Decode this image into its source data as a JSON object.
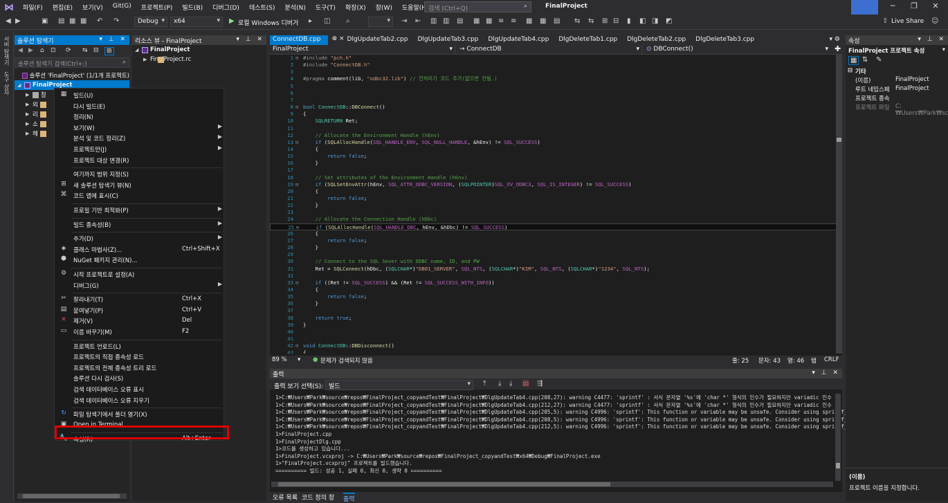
{
  "menubar": {
    "items": [
      "파일(F)",
      "편집(E)",
      "보기(V)",
      "Git(G)",
      "프로젝트(P)",
      "빌드(B)",
      "디버그(D)",
      "테스트(S)",
      "분석(N)",
      "도구(T)",
      "확장(X)",
      "창(W)",
      "도움말(H)"
    ],
    "search_placeholder": "검색 (Ctrl+Q)",
    "title": "FinalProject"
  },
  "toolbar": {
    "config": "Debug",
    "platform": "x64",
    "run_label": "로컬 Windows 디버거",
    "live_share": "Live Share"
  },
  "left_strip": [
    "서버 탐색기",
    "도구 상자"
  ],
  "solution_explorer": {
    "title": "솔루션 탐색기",
    "search_placeholder": "솔루션 탐색기 검색(Ctrl+;)",
    "items": [
      {
        "label": "솔루션 'FinalProject' (1/1개 프로젝트)"
      },
      {
        "label": "FinalProject"
      },
      {
        "label": "참"
      },
      {
        "label": "외"
      },
      {
        "label": "리"
      },
      {
        "label": "소"
      },
      {
        "label": "헤"
      }
    ]
  },
  "resource_view": {
    "title": "리소스 뷰 - FinalProject",
    "items": [
      "FinalProject",
      "FinalProject.rc"
    ]
  },
  "editor": {
    "tabs": [
      "ConnectDB.cpp",
      "DlgUpdateTab2.cpp",
      "DlgUpdateTab3.cpp",
      "DlgUpdateTab4.cpp",
      "DlgDeleteTab1.cpp",
      "DlgDeleteTab2.cpp",
      "DlgDeleteTab3.cpp"
    ],
    "nav_project": "FinalProject",
    "nav_class": "ConnectDB",
    "nav_member": "DBConnect()",
    "zoom": "89 %",
    "issues": "문제가 검색되지 않음",
    "line": "줄: 25",
    "char": "문자: 43",
    "col": "열: 46",
    "tab": "탭",
    "eol": "CRLF"
  },
  "code_lines": [
    "#include \"pch.h\"",
    "#include \"ConnectDB.h\"",
    "",
    "#pragma comment(lib, \"odbc32.lib\") // 전처리기 코드 추가(없으면 안됨.)",
    "",
    "",
    "",
    "bool ConnectDB::DBConnect()",
    "{",
    "    SQLRETURN Ret;",
    "",
    "    // Allocate the Environment Handle (hEnv)",
    "    if (SQLAllocHandle(SQL_HANDLE_ENV, SQL_NULL_HANDLE, &hEnv) != SQL_SUCCESS)",
    "    {",
    "        return false;",
    "    }",
    "",
    "    // Set attributes of the Environment Handle (hEnv)",
    "    if (SQLSetEnvAttr(hEnv, SQL_ATTR_ODBC_VERSION, (SQLPOINTER)SQL_OV_ODBC3, SQL_IS_INTEGER) != SQL_SUCCESS)",
    "    {",
    "        return false;",
    "    }",
    "",
    "    // Allocate the Connection Handle (hDbc)",
    "    if (SQLAllocHandle(SQL_HANDLE_DBC, hEnv, &hDbc) != SQL_SUCCESS)",
    "    {",
    "        return false;",
    "    }",
    "",
    "    // Connect to the SQL Sever with ODBC name, ID, and PW",
    "    Ret = SQLConnect(hDbc, (SQLCHAR*)\"DB01_SERVER\", SQL_NTS, (SQLCHAR*)\"KIM\", SQL_NTS, (SQLCHAR*)\"1234\", SQL_NTS);",
    "",
    "    if ((Ret != SQL_SUCCESS) && (Ret != SQL_SUCCESS_WITH_INFO))",
    "    {",
    "        return false;",
    "    }",
    "",
    "    return true;",
    "}",
    "",
    "",
    "void ConnectDB::DBDisconnect()",
    "{"
  ],
  "output": {
    "title": "출력",
    "source_label": "출력 보기 선택(S):",
    "source_value": "빌드",
    "lines": [
      "1>C:₩Users₩Park₩source₩repos₩FinalProject_copyandTest₩FinalProject₩DlgUpdateTab4.cpp(208,27): warning C4477: 'sprintf' : 서식 문자열 '%s'에 'char *' 형식의 인수가 필요하지만 variadic 인수",
      "1>C:₩Users₩Park₩source₩repos₩FinalProject_copyandTest₩FinalProject₩DlgUpdateTab4.cpp(212,27): warning C4477: 'sprintf' : 서식 문자열 '%s'에 'char *' 형식의 인수가 필요하지만 variadic 인수",
      "1>C:₩Users₩Park₩source₩repos₩FinalProject_copyandTest₩FinalProject₩DlgUpdateTab4.cpp(205,5): warning C4996: 'sprintf': This function or variable may be unsafe. Consider using sprintf_s in",
      "1>C:₩Users₩Park₩source₩repos₩FinalProject_copyandTest₩FinalProject₩DlgUpdateTab4.cpp(208,5): warning C4996: 'sprintf': This function or variable may be unsafe. Consider using sprintf_s in",
      "1>C:₩Users₩Park₩source₩repos₩FinalProject_copyandTest₩FinalProject₩DlgUpdateTab4.cpp(212,5): warning C4996: 'sprintf': This function or variable may be unsafe. Consider using sprintf_s in",
      "1>FinalProject.cpp",
      "1>FinalProjectDlg.cpp",
      "1>코드를 생성하고 있습니다...",
      "1>FinalProject.vcxproj -> C:₩Users₩Park₩source₩repos₩FinalProject_copyandTest₩x64₩Debug₩FinalProject.exe",
      "1>\"FinalProject.vcxproj\" 프로젝트를 빌드했습니다.",
      "========== 빌드: 성공 1, 실패 0, 최신 0, 생략 0 =========="
    ],
    "tabs": [
      "오류 목록",
      "코드 정의 창",
      "출력"
    ]
  },
  "properties": {
    "title": "속성",
    "object": "FinalProject 프로젝트 속성",
    "category": "기타",
    "rows": [
      {
        "k": "(이름)",
        "v": "FinalProject"
      },
      {
        "k": "루트 네임스페",
        "v": "FinalProject"
      },
      {
        "k": "프로젝트 종속",
        "v": ""
      },
      {
        "k": "프로젝트 파일",
        "v": "C:₩Users₩Park₩sc"
      }
    ],
    "desc_title": "(이름)",
    "desc_text": "프로젝트 이름을 지정합니다."
  },
  "context_menu": [
    {
      "label": "빌드(U)",
      "icon": "build-icon"
    },
    {
      "label": "다시 빌드(E)"
    },
    {
      "label": "정리(N)"
    },
    {
      "label": "보기(W)",
      "submenu": true
    },
    {
      "label": "분석 및 코드 정리(Z)",
      "submenu": true
    },
    {
      "label": "프로젝트만(J)",
      "submenu": true
    },
    {
      "label": "프로젝트 대상 변경(R)"
    },
    {
      "sep": true
    },
    {
      "label": "여기까지 범위 지정(S)"
    },
    {
      "label": "새 솔루션 탐색기 뷰(N)",
      "icon": "new-view-icon"
    },
    {
      "label": "코드 맵에 표시(C)",
      "icon": "code-map-icon"
    },
    {
      "sep": true
    },
    {
      "label": "프로필 기반 최적화(P)",
      "submenu": true
    },
    {
      "sep": true
    },
    {
      "label": "빌드 종속성(B)",
      "submenu": true
    },
    {
      "sep": true
    },
    {
      "label": "추가(D)",
      "submenu": true
    },
    {
      "label": "클래스 마법사(Z)...",
      "shortcut": "Ctrl+Shift+X",
      "icon": "class-wizard-icon"
    },
    {
      "label": "NuGet 패키지 관리(N)...",
      "icon": "nuget-icon"
    },
    {
      "sep": true
    },
    {
      "label": "시작 프로젝트로 설정(A)",
      "icon": "gear-icon"
    },
    {
      "label": "디버그(G)",
      "submenu": true
    },
    {
      "sep": true
    },
    {
      "label": "잘라내기(T)",
      "shortcut": "Ctrl+X",
      "icon": "cut-icon"
    },
    {
      "label": "붙여넣기(P)",
      "shortcut": "Ctrl+V",
      "icon": "paste-icon"
    },
    {
      "label": "제거(V)",
      "shortcut": "Del",
      "icon": "remove-icon"
    },
    {
      "label": "이름 바꾸기(M)",
      "shortcut": "F2",
      "icon": "rename-icon"
    },
    {
      "sep": true
    },
    {
      "label": "프로젝트 언로드(L)"
    },
    {
      "label": "프로젝트의 직접 종속성 로드"
    },
    {
      "label": "프로젝트의 전체 종속성 트리 로드"
    },
    {
      "label": "솔루션 다시 검사(S)"
    },
    {
      "label": "검색 데이터베이스 오류 표시"
    },
    {
      "label": "검색 데이터베이스 오류 지우기"
    },
    {
      "sep": true
    },
    {
      "label": "파일 탐색기에서 폴더 열기(X)",
      "icon": "open-folder-icon"
    },
    {
      "label": "Open in Terminal",
      "icon": "terminal-icon"
    },
    {
      "sep": true
    },
    {
      "label": "속성(R)",
      "shortcut": "Alt+Enter",
      "icon": "wrench-icon"
    }
  ],
  "colors": {
    "accent": "#007acc",
    "highlight_border": "#e00000"
  }
}
